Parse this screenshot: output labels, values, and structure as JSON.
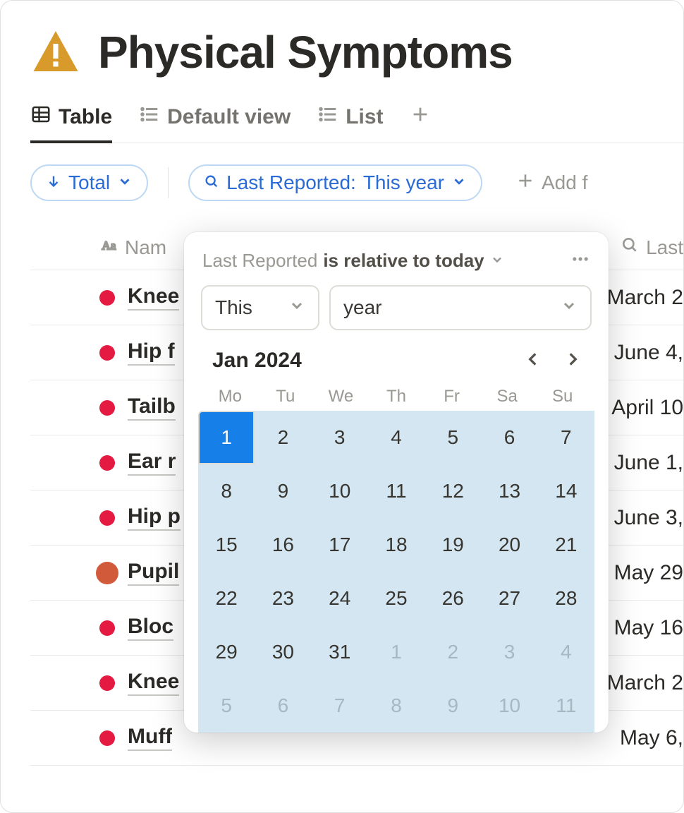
{
  "header": {
    "title": "Physical Symptoms",
    "icon": "warning-icon"
  },
  "tabs": {
    "items": [
      {
        "label": "Table",
        "icon": "table-icon",
        "active": true
      },
      {
        "label": "Default view",
        "icon": "list-icon",
        "active": false
      },
      {
        "label": "List",
        "icon": "list-icon",
        "active": false
      }
    ]
  },
  "filters": {
    "sort": {
      "label": "Total",
      "icon": "arrow-down-icon"
    },
    "filter": {
      "prefix": "Last Reported:",
      "value": "This year",
      "icon": "search-icon"
    },
    "add": {
      "label": "Add f"
    }
  },
  "columns": {
    "name": "Nam",
    "last": "Last"
  },
  "rows": [
    {
      "name": "Knee",
      "dot": "red",
      "date": "March 2"
    },
    {
      "name": "Hip f",
      "dot": "red",
      "date": "June 4,"
    },
    {
      "name": "Tailb",
      "dot": "red",
      "date": "April 10"
    },
    {
      "name": "Ear r",
      "dot": "red",
      "date": "June 1,"
    },
    {
      "name": "Hip p",
      "dot": "red",
      "date": "June 3,"
    },
    {
      "name": "Pupil",
      "dot": "sal",
      "date": "May 29"
    },
    {
      "name": "Bloc",
      "dot": "red",
      "date": "May 16"
    },
    {
      "name": "Knee",
      "dot": "red",
      "date": "March 2"
    },
    {
      "name": "Muff",
      "dot": "red",
      "date": "May 6,"
    }
  ],
  "popover": {
    "field": "Last Reported",
    "predicate": "is relative to today",
    "select1": "This",
    "select2": "year",
    "month": "Jan 2024",
    "dow": [
      "Mo",
      "Tu",
      "We",
      "Th",
      "Fr",
      "Sa",
      "Su"
    ],
    "days": [
      {
        "n": "1",
        "sel": true
      },
      {
        "n": "2"
      },
      {
        "n": "3"
      },
      {
        "n": "4"
      },
      {
        "n": "5"
      },
      {
        "n": "6"
      },
      {
        "n": "7"
      },
      {
        "n": "8"
      },
      {
        "n": "9"
      },
      {
        "n": "10"
      },
      {
        "n": "11"
      },
      {
        "n": "12"
      },
      {
        "n": "13"
      },
      {
        "n": "14"
      },
      {
        "n": "15"
      },
      {
        "n": "16"
      },
      {
        "n": "17"
      },
      {
        "n": "18"
      },
      {
        "n": "19"
      },
      {
        "n": "20"
      },
      {
        "n": "21"
      },
      {
        "n": "22"
      },
      {
        "n": "23"
      },
      {
        "n": "24"
      },
      {
        "n": "25"
      },
      {
        "n": "26"
      },
      {
        "n": "27"
      },
      {
        "n": "28"
      },
      {
        "n": "29"
      },
      {
        "n": "30"
      },
      {
        "n": "31"
      },
      {
        "n": "1",
        "out": true
      },
      {
        "n": "2",
        "out": true
      },
      {
        "n": "3",
        "out": true
      },
      {
        "n": "4",
        "out": true
      },
      {
        "n": "5",
        "out": true
      },
      {
        "n": "6",
        "out": true
      },
      {
        "n": "7",
        "out": true
      },
      {
        "n": "8",
        "out": true
      },
      {
        "n": "9",
        "out": true
      },
      {
        "n": "10",
        "out": true
      },
      {
        "n": "11",
        "out": true
      }
    ]
  }
}
